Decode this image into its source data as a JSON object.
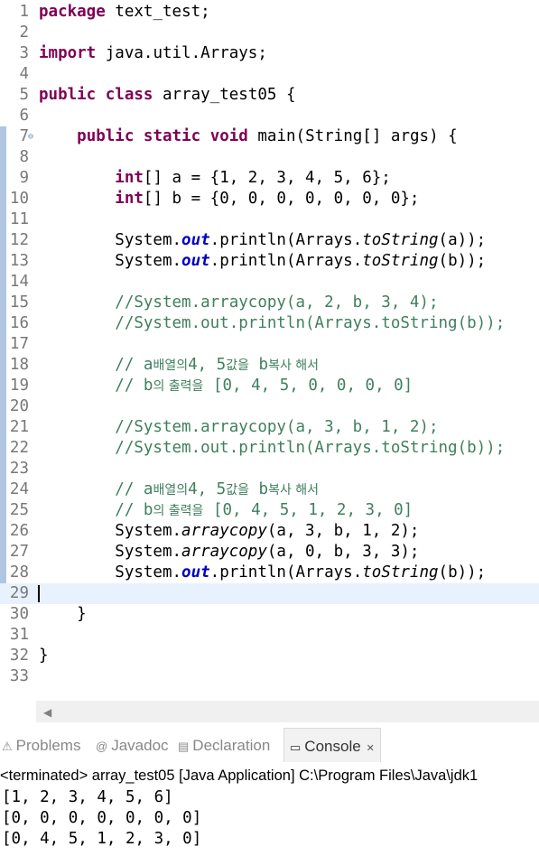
{
  "editor": {
    "lines": [
      {
        "n": "1",
        "p": [
          [
            "kw",
            "package"
          ],
          [
            "",
            "text_test;"
          ]
        ]
      },
      {
        "n": "2",
        "p": []
      },
      {
        "n": "3",
        "p": [
          [
            "kw",
            "import"
          ],
          [
            "",
            "java.util.Arrays;"
          ]
        ]
      },
      {
        "n": "4",
        "p": []
      },
      {
        "n": "5",
        "p": [
          [
            "kw",
            "public"
          ],
          [
            "kw",
            "class"
          ],
          [
            "",
            "array_test05 {"
          ]
        ]
      },
      {
        "n": "6",
        "p": []
      },
      {
        "n": "7",
        "p": [
          [
            "",
            "    "
          ],
          [
            "kw",
            "public"
          ],
          [
            "kw",
            "static"
          ],
          [
            "kw",
            "void"
          ],
          [
            "",
            "main(String[] "
          ],
          [
            "",
            "args"
          ],
          [
            "",
            ") {"
          ]
        ]
      },
      {
        "n": "8",
        "p": []
      },
      {
        "n": "9",
        "p": [
          [
            "",
            "        "
          ],
          [
            "kw",
            "int"
          ],
          [
            "",
            "[] a = {1, 2, 3, 4, 5, 6};"
          ]
        ]
      },
      {
        "n": "10",
        "p": [
          [
            "",
            "        "
          ],
          [
            "kw",
            "int"
          ],
          [
            "",
            "[] b = {0, 0, 0, 0, 0, 0, 0};"
          ]
        ]
      },
      {
        "n": "11",
        "p": []
      },
      {
        "n": "12",
        "p": [
          [
            "",
            "        System."
          ],
          [
            "fld",
            "out"
          ],
          [
            "",
            ".println(Arrays."
          ],
          [
            "st",
            "toString"
          ],
          [
            "",
            "(a));"
          ]
        ]
      },
      {
        "n": "13",
        "p": [
          [
            "",
            "        System."
          ],
          [
            "fld",
            "out"
          ],
          [
            "",
            ".println(Arrays."
          ],
          [
            "st",
            "toString"
          ],
          [
            "",
            "(b));"
          ]
        ]
      },
      {
        "n": "14",
        "p": []
      },
      {
        "n": "15",
        "p": [
          [
            "cm",
            "        //System.arraycopy(a, 2, b, 3, 4);"
          ]
        ]
      },
      {
        "n": "16",
        "p": [
          [
            "cm",
            "        //System.out.println(Arrays.toString(b));"
          ]
        ]
      },
      {
        "n": "17",
        "p": []
      },
      {
        "n": "18",
        "p": [
          [
            "cm",
            "        // a"
          ],
          [
            "cmko",
            "배열의"
          ],
          [
            "cm",
            "4, 5"
          ],
          [
            "cmko",
            "값을"
          ],
          [
            "cm",
            " b"
          ],
          [
            "cmko",
            "복사 해서"
          ]
        ]
      },
      {
        "n": "19",
        "p": [
          [
            "cm",
            "        // b"
          ],
          [
            "cmko",
            "의 출력을"
          ],
          [
            "cm",
            " [0, 4, 5, 0, 0, 0, 0]"
          ]
        ]
      },
      {
        "n": "20",
        "p": []
      },
      {
        "n": "21",
        "p": [
          [
            "cm",
            "        //System.arraycopy(a, 3, b, 1, 2);"
          ]
        ]
      },
      {
        "n": "22",
        "p": [
          [
            "cm",
            "        //System.out.println(Arrays.toString(b));"
          ]
        ]
      },
      {
        "n": "23",
        "p": []
      },
      {
        "n": "24",
        "p": [
          [
            "cm",
            "        // a"
          ],
          [
            "cmko",
            "배열의"
          ],
          [
            "cm",
            "4, 5"
          ],
          [
            "cmko",
            "값을"
          ],
          [
            "cm",
            " b"
          ],
          [
            "cmko",
            "복사 해서"
          ]
        ]
      },
      {
        "n": "25",
        "p": [
          [
            "cm",
            "        // b"
          ],
          [
            "cmko",
            "의 출력을"
          ],
          [
            "cm",
            " [0, 4, 5, 1, 2, 3, 0]"
          ]
        ]
      },
      {
        "n": "26",
        "p": [
          [
            "",
            "        System."
          ],
          [
            "st",
            "arraycopy"
          ],
          [
            "",
            "(a, 3, b, 1, 2);"
          ]
        ]
      },
      {
        "n": "27",
        "p": [
          [
            "",
            "        System."
          ],
          [
            "st",
            "arraycopy"
          ],
          [
            "",
            "(a, 0, b, 3, 3);"
          ]
        ]
      },
      {
        "n": "28",
        "p": [
          [
            "",
            "        System."
          ],
          [
            "fld",
            "out"
          ],
          [
            "",
            ".println(Arrays."
          ],
          [
            "st",
            "toString"
          ],
          [
            "",
            "(b));"
          ]
        ]
      },
      {
        "n": "29",
        "p": []
      },
      {
        "n": "30",
        "p": [
          [
            "",
            "    }"
          ]
        ]
      },
      {
        "n": "31",
        "p": []
      },
      {
        "n": "32",
        "p": [
          [
            "",
            "}"
          ]
        ]
      },
      {
        "n": "33",
        "p": []
      }
    ]
  },
  "tabs": [
    {
      "label": "Problems",
      "icon": "problems-icon"
    },
    {
      "label": "Javadoc",
      "icon": "javadoc-icon"
    },
    {
      "label": "Declaration",
      "icon": "declaration-icon"
    },
    {
      "label": "Console",
      "icon": "console-icon",
      "active": true
    }
  ],
  "console": {
    "header": "<terminated> array_test05 [Java Application] C:\\Program Files\\Java\\jdk1",
    "output": [
      "[1, 2, 3, 4, 5, 6]",
      "[0, 0, 0, 0, 0, 0, 0]",
      "[0, 4, 5, 1, 2, 3, 0]"
    ]
  }
}
